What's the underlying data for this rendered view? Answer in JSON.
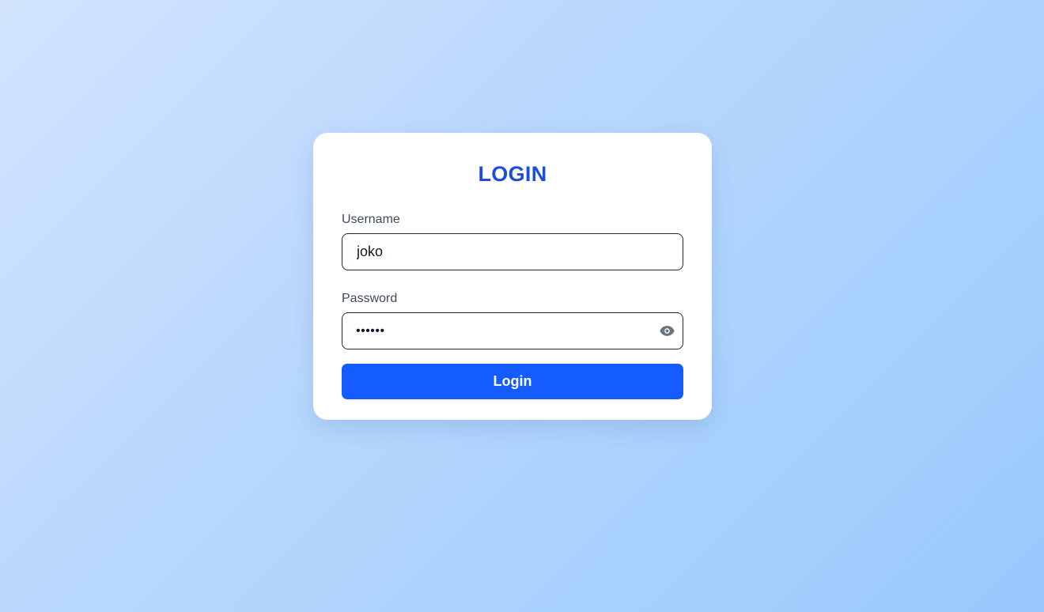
{
  "login_form": {
    "title": "LOGIN",
    "username": {
      "label": "Username",
      "value": "joko"
    },
    "password": {
      "label": "Password",
      "value": "joko12",
      "masked": true,
      "toggle_icon": "eye-icon"
    },
    "submit_label": "Login"
  },
  "colors": {
    "title": "#1d4ed8",
    "button": "#155cff",
    "background_start": "#d2e4fe",
    "background_end": "#98c8fd"
  }
}
